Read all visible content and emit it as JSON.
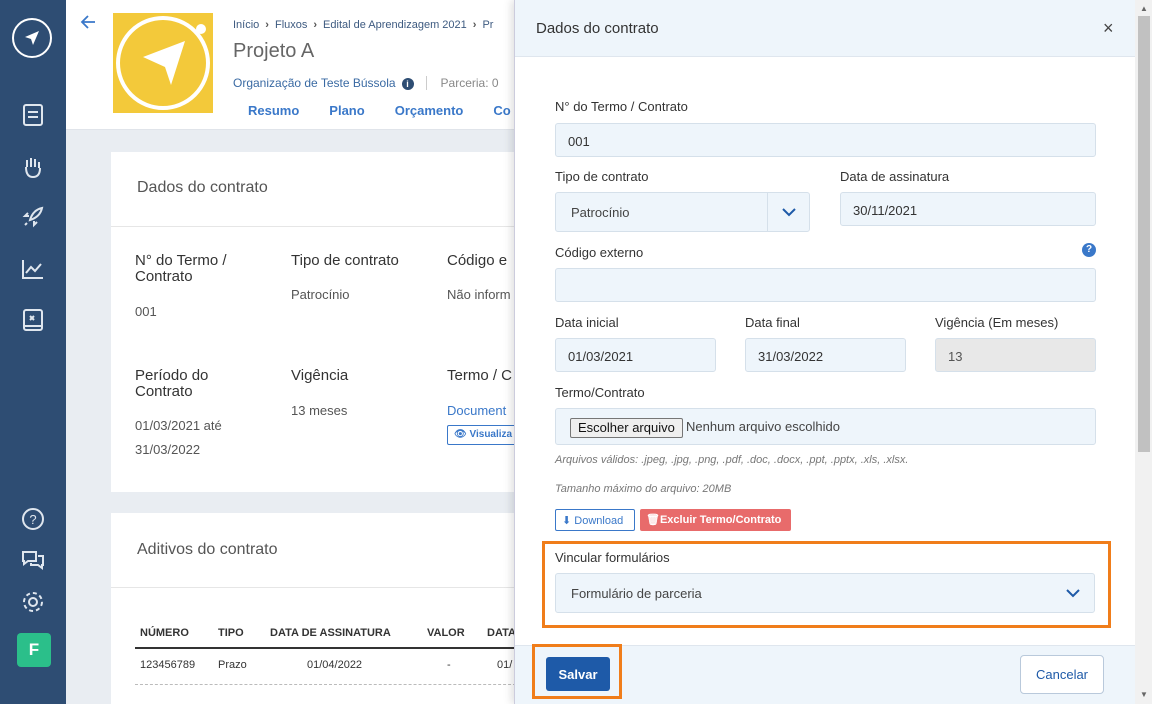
{
  "sidebar": {
    "icons": [
      "compass-icon",
      "document-list-icon",
      "hand-heart-icon",
      "rocket-icon",
      "chart-line-icon",
      "book-icon"
    ],
    "bottom_icons": [
      "help-icon",
      "chat-icon",
      "gear-icon"
    ],
    "avatar_letter": "F"
  },
  "header": {
    "breadcrumb": [
      "Início",
      "Fluxos",
      "Edital de Aprendizagem 2021",
      "Pr"
    ],
    "project_title": "Projeto A",
    "organization": "Organização de Teste Bússola",
    "info_icon": "i",
    "parceria": "Parceria: 0",
    "tabs": [
      "Resumo",
      "Plano",
      "Orçamento",
      "Co"
    ]
  },
  "contract_card": {
    "title": "Dados do contrato",
    "term_label": "N° do Termo / Contrato",
    "term_value": "001",
    "type_label": "Tipo de contrato",
    "type_value": "Patrocínio",
    "code_label": "Código e",
    "code_value": "Não inform",
    "period_label": "Período do Contrato",
    "period_value_1": "01/03/2021 até",
    "period_value_2": "31/03/2022",
    "validity_label": "Vigência",
    "validity_value": "13 meses",
    "term_doc_label": "Termo / C",
    "doc_link": "Document",
    "view_button": "Visualiza"
  },
  "additives_card": {
    "title": "Aditivos do contrato",
    "columns": [
      "NÚMERO",
      "TIPO",
      "DATA DE ASSINATURA",
      "VALOR",
      "DATA"
    ],
    "row": [
      "123456789",
      "Prazo",
      "01/04/2022",
      "-",
      "01/"
    ]
  },
  "modal": {
    "title": "Dados do contrato",
    "close": "×",
    "term_label": "N° do Termo / Contrato",
    "term_value": "001",
    "type_label": "Tipo de contrato",
    "type_value": "Patrocínio",
    "sign_label": "Data de assinatura",
    "sign_value": "30/11/2021",
    "external_label": "Código externo",
    "external_value": "",
    "help": "?",
    "start_label": "Data inicial",
    "start_value": "01/03/2021",
    "end_label": "Data final",
    "end_value": "31/03/2022",
    "validity_label": "Vigência (Em meses)",
    "validity_value": "13",
    "file_label": "Termo/Contrato",
    "file_button": "Escolher arquivo",
    "file_none": "Nenhum arquivo escolhido",
    "valid_files": "Arquivos válidos: .jpeg, .jpg, .png, .pdf, .doc, .docx, .ppt, .pptx, .xls, .xlsx.",
    "max_size": "Tamanho máximo do arquivo: 20MB",
    "download_button": "Download",
    "delete_button": "Excluir Termo/Contrato",
    "forms_label": "Vincular formulários",
    "forms_value": "Formulário de parceria",
    "save_button": "Salvar",
    "cancel_button": "Cancelar"
  },
  "colors": {
    "sidebar": "#2e4d73",
    "accent": "#1e5aa8",
    "highlight": "#f07d1a",
    "danger": "#e86b6b",
    "logo_bg": "#f3c93a"
  }
}
